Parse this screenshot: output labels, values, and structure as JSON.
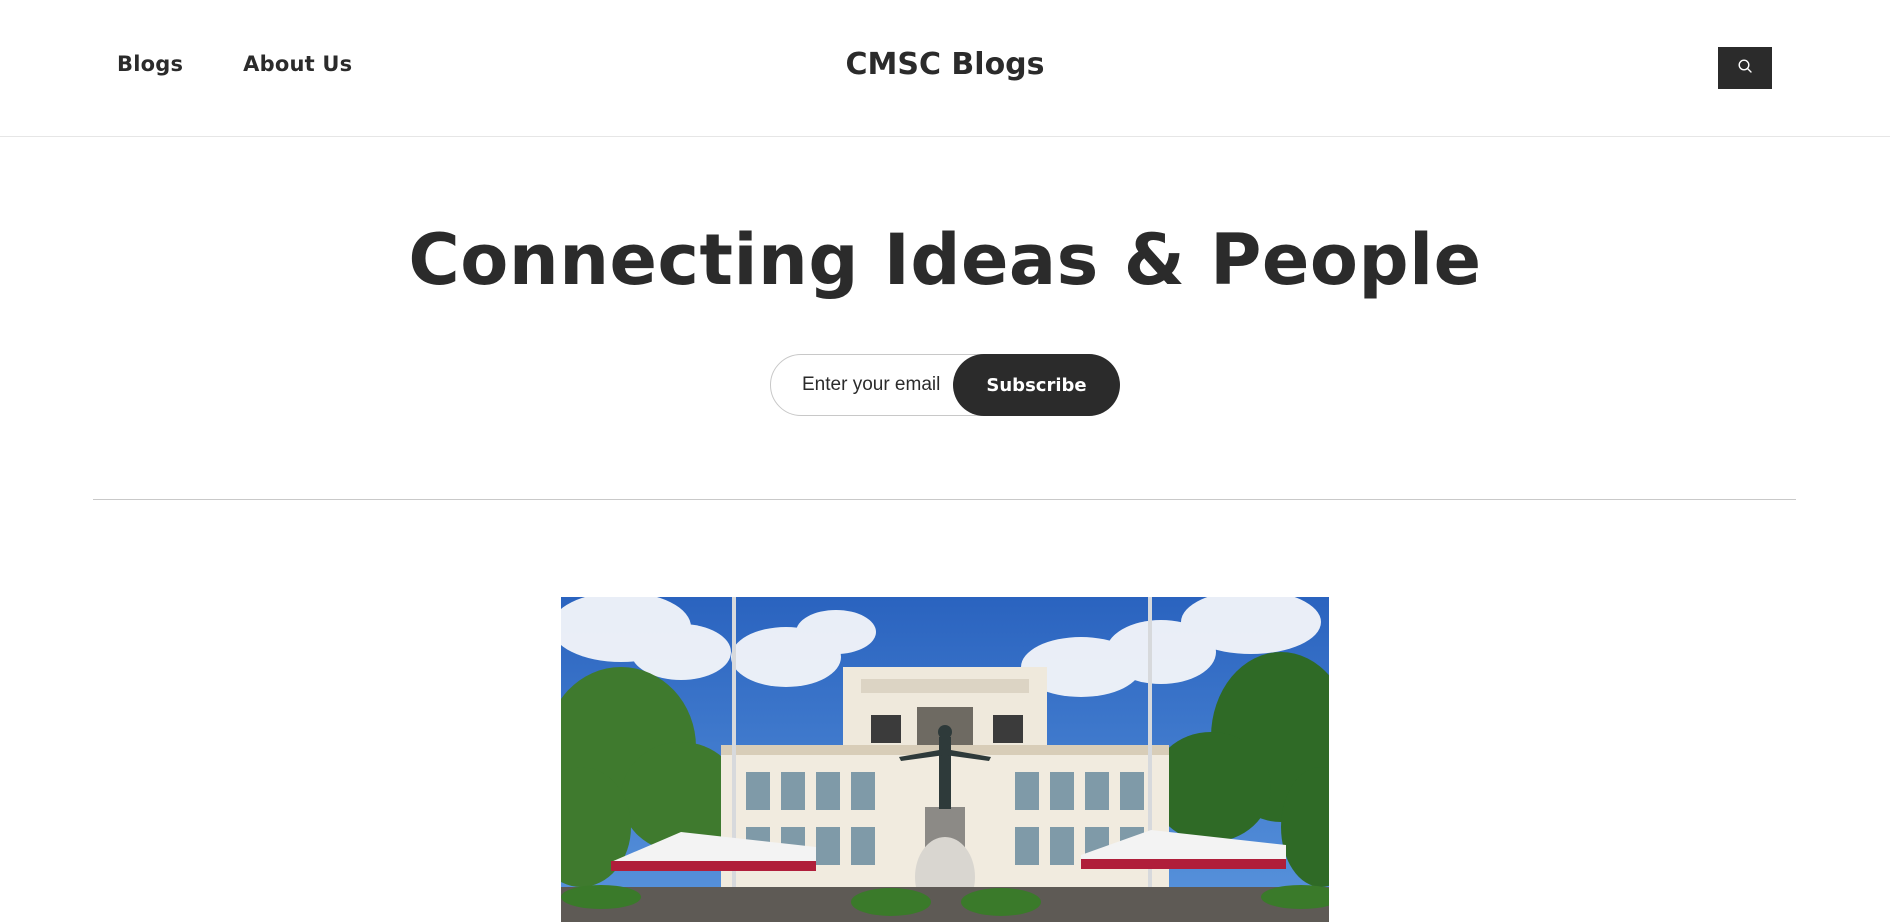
{
  "header": {
    "nav": [
      {
        "label": "Blogs"
      },
      {
        "label": "About Us"
      }
    ],
    "site_title": "CMSC Blogs",
    "search_icon": "search-icon"
  },
  "hero": {
    "title": "Connecting Ideas & People"
  },
  "subscribe": {
    "placeholder": "Enter your email",
    "button_label": "Subscribe"
  },
  "featured": {
    "image_description_icon": "campus-building-photo"
  },
  "colors": {
    "text": "#2b2b2b",
    "button_bg": "#2b2b2b",
    "button_text": "#ffffff",
    "divider": "#c9c9c9",
    "sky": "#2f6fc7"
  }
}
